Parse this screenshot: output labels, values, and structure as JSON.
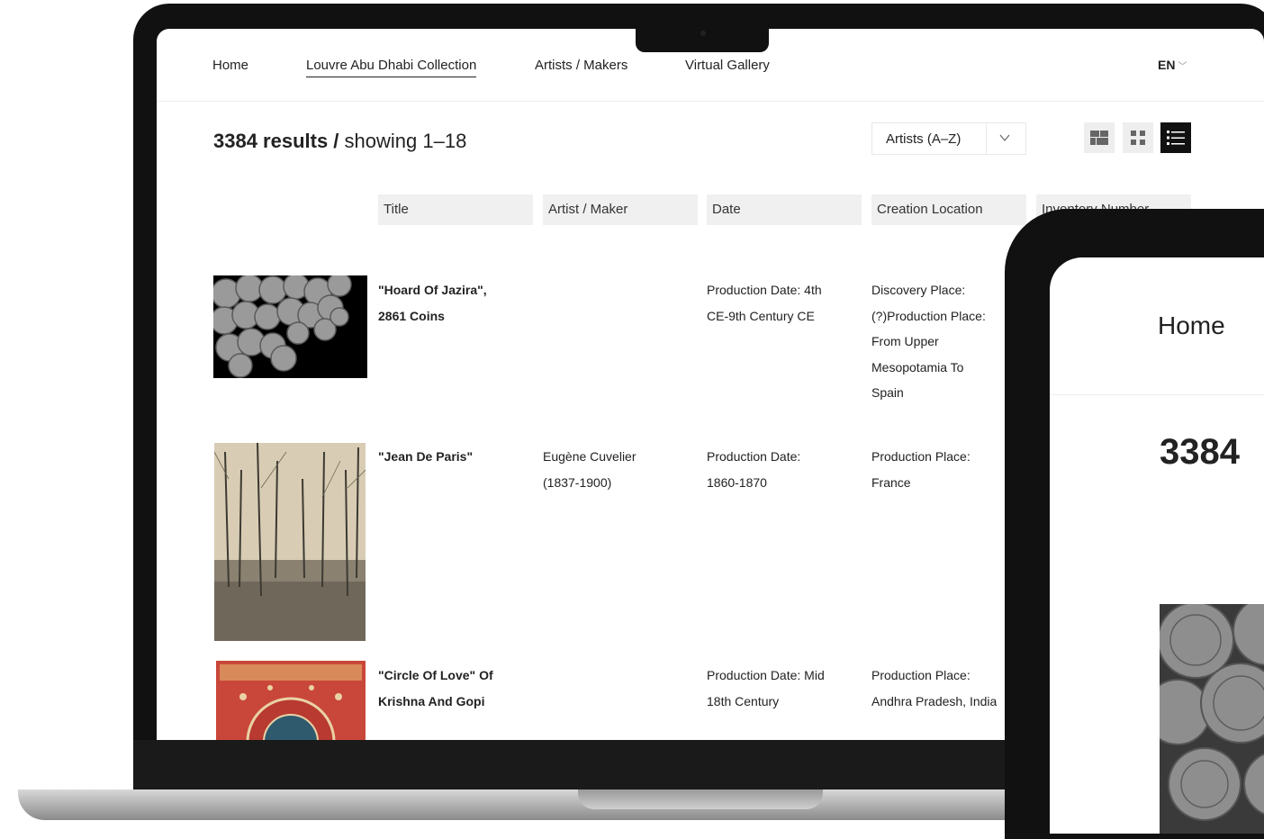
{
  "nav": {
    "items": [
      "Home",
      "Louvre Abu Dhabi Collection",
      "Artists / Makers",
      "Virtual Gallery"
    ],
    "active_index": 1,
    "lang": "EN"
  },
  "results": {
    "count": "3384 results /",
    "showing": " showing 1–18"
  },
  "sort": {
    "selected": "Artists (A–Z)"
  },
  "view_modes": [
    "large-grid",
    "small-grid",
    "list"
  ],
  "table": {
    "headers": [
      "Title",
      "Artist / Maker",
      "Date",
      "Creation Location",
      "Inventory Number"
    ],
    "rows": [
      {
        "title_lines": [
          "\"Hoard Of Jazira\",",
          "2861 Coins"
        ],
        "artist_lines": [],
        "date_lines": [
          "Production Date: 4th",
          "CE-9th Century CE"
        ],
        "location_lines": [
          "Discovery Place:",
          "(?)Production Place:",
          "From Upper",
          "Mesopotamia To",
          "Spain"
        ]
      },
      {
        "title_lines": [
          "\"Jean De Paris\""
        ],
        "artist_lines": [
          "Eugène Cuvelier",
          "(1837-1900)"
        ],
        "date_lines": [
          "Production Date:",
          "1860-1870"
        ],
        "location_lines": [
          "Production Place:",
          "France"
        ]
      },
      {
        "title_lines": [
          "\"Circle Of Love\" Of",
          "Krishna And Gopi"
        ],
        "artist_lines": [],
        "date_lines": [
          "Production Date: Mid",
          "18th Century"
        ],
        "location_lines": [
          "Production Place:",
          "Andhra Pradesh, India"
        ]
      }
    ]
  },
  "tablet": {
    "nav_home": "Home",
    "count": "3384"
  }
}
